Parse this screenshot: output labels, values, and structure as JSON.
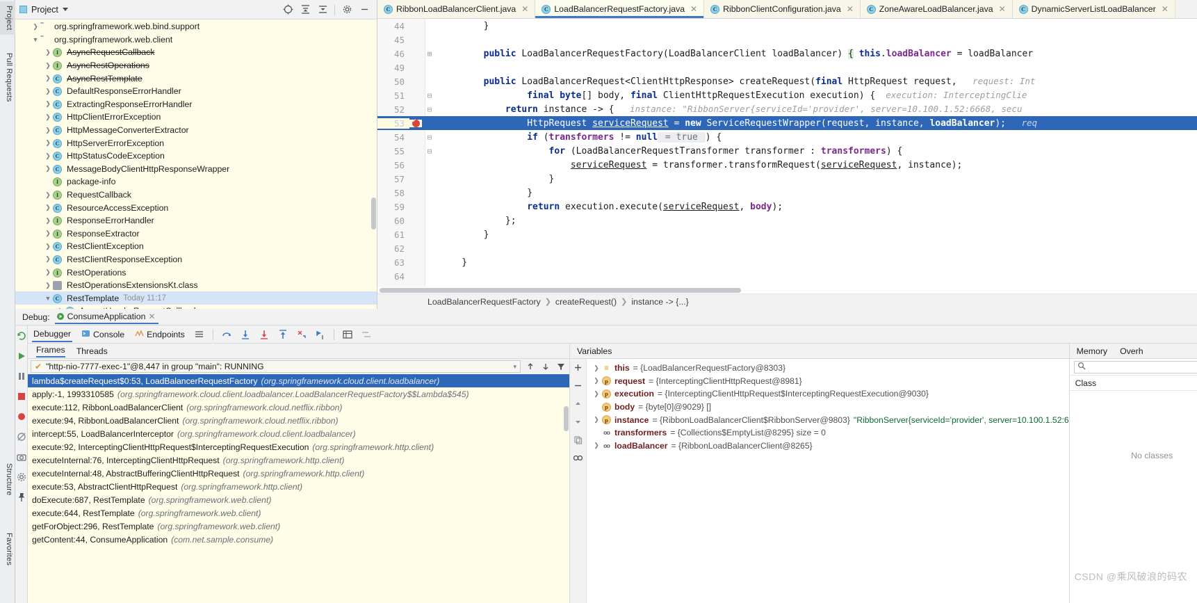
{
  "left_strip": {
    "tabs": [
      {
        "label": "Project",
        "selected": true
      },
      {
        "label": "Pull Requests",
        "selected": false
      },
      {
        "label": "Structure",
        "selected": false
      },
      {
        "label": "Favorites",
        "selected": false
      }
    ]
  },
  "project_panel": {
    "title": "Project",
    "toolbar_icons": [
      "locate-icon",
      "expand-all-icon",
      "collapse-all-icon",
      "gear-icon",
      "minimize-icon"
    ],
    "tree": [
      {
        "indent": 1,
        "arrow": "collapsed",
        "icon": "folder-icon",
        "label": "org.springframework.web.bind.support",
        "strike": false
      },
      {
        "indent": 1,
        "arrow": "expanded",
        "icon": "folder-icon",
        "label": "org.springframework.web.client",
        "strike": false
      },
      {
        "indent": 2,
        "arrow": "collapsed",
        "icon": "interface-icon",
        "label": "AsyncRequestCallback",
        "strike": true
      },
      {
        "indent": 2,
        "arrow": "collapsed",
        "icon": "interface-icon",
        "label": "AsyncRestOperations",
        "strike": true
      },
      {
        "indent": 2,
        "arrow": "collapsed",
        "icon": "class-icon",
        "label": "AsyncRestTemplate",
        "strike": true
      },
      {
        "indent": 2,
        "arrow": "collapsed",
        "icon": "class-icon",
        "label": "DefaultResponseErrorHandler",
        "strike": false
      },
      {
        "indent": 2,
        "arrow": "collapsed",
        "icon": "class-icon",
        "label": "ExtractingResponseErrorHandler",
        "strike": false
      },
      {
        "indent": 2,
        "arrow": "collapsed",
        "icon": "class-icon",
        "label": "HttpClientErrorException",
        "strike": false
      },
      {
        "indent": 2,
        "arrow": "collapsed",
        "icon": "class-icon",
        "label": "HttpMessageConverterExtractor",
        "strike": false
      },
      {
        "indent": 2,
        "arrow": "collapsed",
        "icon": "class-icon",
        "label": "HttpServerErrorException",
        "strike": false
      },
      {
        "indent": 2,
        "arrow": "collapsed",
        "icon": "class-icon",
        "label": "HttpStatusCodeException",
        "strike": false
      },
      {
        "indent": 2,
        "arrow": "collapsed",
        "icon": "class-icon",
        "label": "MessageBodyClientHttpResponseWrapper",
        "strike": false
      },
      {
        "indent": 2,
        "arrow": "none",
        "icon": "interface-icon",
        "label": "package-info",
        "strike": false
      },
      {
        "indent": 2,
        "arrow": "collapsed",
        "icon": "interface-icon",
        "label": "RequestCallback",
        "strike": false
      },
      {
        "indent": 2,
        "arrow": "collapsed",
        "icon": "class-icon",
        "label": "ResourceAccessException",
        "strike": false
      },
      {
        "indent": 2,
        "arrow": "collapsed",
        "icon": "interface-icon",
        "label": "ResponseErrorHandler",
        "strike": false
      },
      {
        "indent": 2,
        "arrow": "collapsed",
        "icon": "interface-icon",
        "label": "ResponseExtractor",
        "strike": false
      },
      {
        "indent": 2,
        "arrow": "collapsed",
        "icon": "class-icon",
        "label": "RestClientException",
        "strike": false
      },
      {
        "indent": 2,
        "arrow": "collapsed",
        "icon": "class-icon",
        "label": "RestClientResponseException",
        "strike": false
      },
      {
        "indent": 2,
        "arrow": "collapsed",
        "icon": "interface-icon",
        "label": "RestOperations",
        "strike": false
      },
      {
        "indent": 2,
        "arrow": "collapsed",
        "icon": "kotlin-icon",
        "label": "RestOperationsExtensionsKt.class",
        "strike": false
      },
      {
        "indent": 2,
        "arrow": "expanded",
        "icon": "class-icon",
        "label": "RestTemplate",
        "strike": false,
        "timestamp": "Today 11:17",
        "selected": true
      },
      {
        "indent": 3,
        "arrow": "collapsed",
        "icon": "class-icon",
        "label": "AcceptHeaderRequestCallback",
        "strike": false
      }
    ]
  },
  "editor": {
    "tabs": [
      {
        "label": "RibbonLoadBalancerClient.java",
        "active": false
      },
      {
        "label": "LoadBalancerRequestFactory.java",
        "active": true
      },
      {
        "label": "RibbonClientConfiguration.java",
        "active": false
      },
      {
        "label": "ZoneAwareLoadBalancer.java",
        "active": false
      },
      {
        "label": "DynamicServerListLoadBalancer",
        "active": false
      }
    ],
    "lines": [
      {
        "num": "44",
        "fold": "",
        "bp": false,
        "hl": false,
        "segs": [
          {
            "t": "        }",
            "c": "plain"
          }
        ]
      },
      {
        "num": "45",
        "fold": "",
        "bp": false,
        "hl": false,
        "segs": []
      },
      {
        "num": "46",
        "fold": "plus",
        "bp": false,
        "hl": false,
        "segs": [
          {
            "t": "        ",
            "c": "plain"
          },
          {
            "t": "public",
            "c": "kw"
          },
          {
            "t": " LoadBalancerRequestFactory(LoadBalancerClient loadBalancer) ",
            "c": "plain"
          },
          {
            "t": "{",
            "c": "brace"
          },
          {
            "t": " ",
            "c": "plain"
          },
          {
            "t": "this",
            "c": "kw"
          },
          {
            "t": ".",
            "c": "plain"
          },
          {
            "t": "loadBalancer",
            "c": "field"
          },
          {
            "t": " = loadBalancer",
            "c": "plain"
          }
        ]
      },
      {
        "num": "49",
        "fold": "",
        "bp": false,
        "hl": false,
        "segs": []
      },
      {
        "num": "50",
        "fold": "",
        "bp": false,
        "hl": false,
        "segs": [
          {
            "t": "        ",
            "c": "plain"
          },
          {
            "t": "public",
            "c": "kw"
          },
          {
            "t": " LoadBalancerRequest<ClientHttpResponse> createRequest(",
            "c": "plain"
          },
          {
            "t": "final",
            "c": "kw"
          },
          {
            "t": " HttpRequest request,",
            "c": "plain"
          },
          {
            "t": "   request: Int",
            "c": "hint"
          }
        ]
      },
      {
        "num": "51",
        "fold": "minus",
        "bp": false,
        "hl": false,
        "segs": [
          {
            "t": "                ",
            "c": "plain"
          },
          {
            "t": "final",
            "c": "kw"
          },
          {
            "t": " ",
            "c": "plain"
          },
          {
            "t": "byte",
            "c": "kw"
          },
          {
            "t": "[] body, ",
            "c": "plain"
          },
          {
            "t": "final",
            "c": "kw"
          },
          {
            "t": " ClientHttpRequestExecution execution) {",
            "c": "plain"
          },
          {
            "t": "  execution: InterceptingClie",
            "c": "hint"
          }
        ]
      },
      {
        "num": "52",
        "fold": "minus",
        "bp": false,
        "hl": false,
        "segs": [
          {
            "t": "            ",
            "c": "plain"
          },
          {
            "t": "return",
            "c": "kw"
          },
          {
            "t": " instance -> {",
            "c": "plain"
          },
          {
            "t": "   instance: \"RibbonServer{serviceId='provider', server=10.100.1.52:6668, secu",
            "c": "hint"
          }
        ]
      },
      {
        "num": "53",
        "fold": "",
        "bp": true,
        "hl": true,
        "segs": [
          {
            "t": "                ",
            "c": "plain"
          },
          {
            "t": "HttpRequest ",
            "c": "plain"
          },
          {
            "t": "serviceRequest",
            "c": "local"
          },
          {
            "t": " = ",
            "c": "plain"
          },
          {
            "t": "new",
            "c": "kw"
          },
          {
            "t": " ServiceRequestWrapper(request, instance, ",
            "c": "plain"
          },
          {
            "t": "loadBalancer",
            "c": "field"
          },
          {
            "t": ");",
            "c": "plain"
          },
          {
            "t": "   req",
            "c": "hint"
          }
        ]
      },
      {
        "num": "54",
        "fold": "minus",
        "bp": false,
        "hl": false,
        "segs": [
          {
            "t": "                ",
            "c": "plain"
          },
          {
            "t": "if",
            "c": "kw"
          },
          {
            "t": " (",
            "c": "plain"
          },
          {
            "t": "transformers",
            "c": "field"
          },
          {
            "t": " != ",
            "c": "plain"
          },
          {
            "t": "null",
            "c": "kw"
          },
          {
            "t": " = true ",
            "c": "inlay"
          },
          {
            "t": ") {",
            "c": "plain"
          }
        ]
      },
      {
        "num": "55",
        "fold": "minus",
        "bp": false,
        "hl": false,
        "segs": [
          {
            "t": "                    ",
            "c": "plain"
          },
          {
            "t": "for",
            "c": "kw"
          },
          {
            "t": " (LoadBalancerRequestTransformer transformer : ",
            "c": "plain"
          },
          {
            "t": "transformers",
            "c": "field"
          },
          {
            "t": ") {",
            "c": "plain"
          }
        ]
      },
      {
        "num": "56",
        "fold": "",
        "bp": false,
        "hl": false,
        "segs": [
          {
            "t": "                        ",
            "c": "plain"
          },
          {
            "t": "serviceRequest",
            "c": "local"
          },
          {
            "t": " = transformer.transformRequest(",
            "c": "plain"
          },
          {
            "t": "serviceRequest",
            "c": "local"
          },
          {
            "t": ", instance);",
            "c": "plain"
          }
        ]
      },
      {
        "num": "57",
        "fold": "",
        "bp": false,
        "hl": false,
        "segs": [
          {
            "t": "                    }",
            "c": "plain"
          }
        ]
      },
      {
        "num": "58",
        "fold": "",
        "bp": false,
        "hl": false,
        "segs": [
          {
            "t": "                }",
            "c": "plain"
          }
        ]
      },
      {
        "num": "59",
        "fold": "",
        "bp": false,
        "hl": false,
        "segs": [
          {
            "t": "                ",
            "c": "plain"
          },
          {
            "t": "return",
            "c": "kw"
          },
          {
            "t": " execution.execute(",
            "c": "plain"
          },
          {
            "t": "serviceRequest",
            "c": "local"
          },
          {
            "t": ", ",
            "c": "plain"
          },
          {
            "t": "body",
            "c": "field"
          },
          {
            "t": ");",
            "c": "plain"
          }
        ]
      },
      {
        "num": "60",
        "fold": "",
        "bp": false,
        "hl": false,
        "segs": [
          {
            "t": "            };",
            "c": "plain"
          }
        ]
      },
      {
        "num": "61",
        "fold": "",
        "bp": false,
        "hl": false,
        "segs": [
          {
            "t": "        }",
            "c": "plain"
          }
        ]
      },
      {
        "num": "62",
        "fold": "",
        "bp": false,
        "hl": false,
        "segs": []
      },
      {
        "num": "63",
        "fold": "",
        "bp": false,
        "hl": false,
        "segs": [
          {
            "t": "    }",
            "c": "plain"
          }
        ]
      },
      {
        "num": "64",
        "fold": "",
        "bp": false,
        "hl": false,
        "segs": []
      }
    ],
    "breadcrumb": [
      "LoadBalancerRequestFactory",
      "createRequest()",
      "instance -> {...}"
    ]
  },
  "debug": {
    "label": "Debug:",
    "config_name": "ConsumeApplication",
    "tabs": [
      {
        "label": "Debugger",
        "active": true,
        "icon": "bug-icon"
      },
      {
        "label": "Console",
        "active": false,
        "icon": "console-icon"
      },
      {
        "label": "Endpoints",
        "active": false,
        "icon": "endpoints-icon"
      }
    ],
    "frames_tabs": [
      {
        "label": "Frames",
        "active": true
      },
      {
        "label": "Threads",
        "active": false
      }
    ],
    "thread_selector": "\"http-nio-7777-exec-1\"@8,447 in group \"main\": RUNNING",
    "frames": [
      {
        "method": "lambda$createRequest$0:53, LoadBalancerRequestFactory",
        "pkg": "(org.springframework.cloud.client.loadbalancer)",
        "selected": true
      },
      {
        "method": "apply:-1, 1993310585",
        "pkg": "(org.springframework.cloud.client.loadbalancer.LoadBalancerRequestFactory$$Lambda$545)",
        "selected": false
      },
      {
        "method": "execute:112, RibbonLoadBalancerClient",
        "pkg": "(org.springframework.cloud.netflix.ribbon)",
        "selected": false
      },
      {
        "method": "execute:94, RibbonLoadBalancerClient",
        "pkg": "(org.springframework.cloud.netflix.ribbon)",
        "selected": false
      },
      {
        "method": "intercept:55, LoadBalancerInterceptor",
        "pkg": "(org.springframework.cloud.client.loadbalancer)",
        "selected": false
      },
      {
        "method": "execute:92, InterceptingClientHttpRequest$InterceptingRequestExecution",
        "pkg": "(org.springframework.http.client)",
        "selected": false
      },
      {
        "method": "executeInternal:76, InterceptingClientHttpRequest",
        "pkg": "(org.springframework.http.client)",
        "selected": false
      },
      {
        "method": "executeInternal:48, AbstractBufferingClientHttpRequest",
        "pkg": "(org.springframework.http.client)",
        "selected": false
      },
      {
        "method": "execute:53, AbstractClientHttpRequest",
        "pkg": "(org.springframework.http.client)",
        "selected": false
      },
      {
        "method": "doExecute:687, RestTemplate",
        "pkg": "(org.springframework.web.client)",
        "selected": false
      },
      {
        "method": "execute:644, RestTemplate",
        "pkg": "(org.springframework.web.client)",
        "selected": false
      },
      {
        "method": "getForObject:296, RestTemplate",
        "pkg": "(org.springframework.web.client)",
        "selected": false
      },
      {
        "method": "getContent:44, ConsumeApplication",
        "pkg": "(com.net.sample.consume)",
        "selected": false
      }
    ],
    "variables_title": "Variables",
    "variables": [
      {
        "arrow": "collapsed",
        "badge": "this",
        "name": "this",
        "value": "= {LoadBalancerRequestFactory@8303}",
        "extra": ""
      },
      {
        "arrow": "collapsed",
        "badge": "p",
        "name": "request",
        "value": "= {InterceptingClientHttpRequest@8981}",
        "extra": ""
      },
      {
        "arrow": "collapsed",
        "badge": "p",
        "name": "execution",
        "value": "= {InterceptingClientHttpRequest$InterceptingRequestExecution@9030}",
        "extra": ""
      },
      {
        "arrow": "none",
        "badge": "p",
        "name": "body",
        "value": "= {byte[0]@9029} []",
        "extra": ""
      },
      {
        "arrow": "collapsed",
        "badge": "p",
        "name": "instance",
        "value": "= {RibbonLoadBalancerClient$RibbonServer@9803}",
        "extra": "\"RibbonServer{serviceId='provider', server=10.100.1.52:6"
      },
      {
        "arrow": "none",
        "badge": "oo",
        "name": "transformers",
        "value": "= {Collections$EmptyList@8295}  size = 0",
        "extra": ""
      },
      {
        "arrow": "collapsed",
        "badge": "oo",
        "name": "loadBalancer",
        "value": "= {RibbonLoadBalancerClient@8265}",
        "extra": ""
      }
    ],
    "memory": {
      "tabs": [
        {
          "label": "Memory",
          "active": false
        },
        {
          "label": "Overh",
          "active": false
        }
      ],
      "search_placeholder": "",
      "column_header": "Class",
      "empty_text": "No classes"
    }
  },
  "watermark": "CSDN @乘风破浪的码农"
}
